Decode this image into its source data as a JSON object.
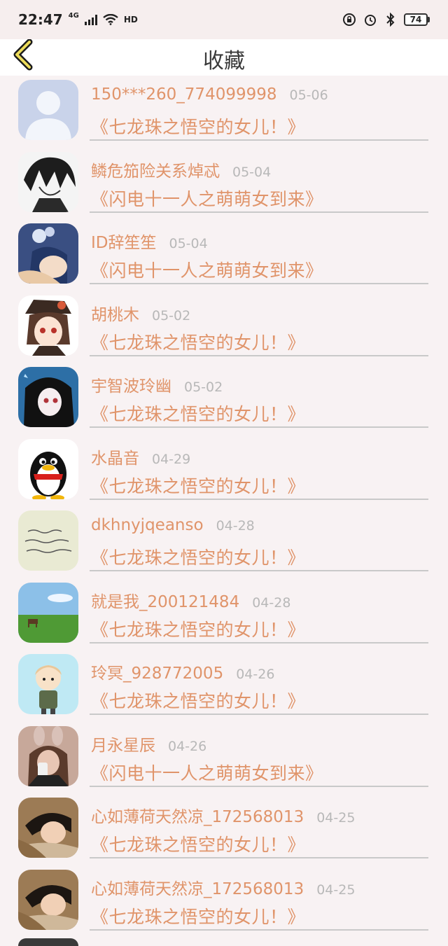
{
  "status": {
    "time": "22:47",
    "network": "4G",
    "hd": "HD",
    "battery": "74"
  },
  "nav": {
    "title": "收藏"
  },
  "colors": {
    "accent": "#e0946a",
    "date": "#b8b8b8",
    "background": "#f8f2f3"
  },
  "items": [
    {
      "user": "150***260_774099998",
      "date": "05-06",
      "title": "《七龙珠之悟空的女儿！》",
      "avatar": "default-avatar"
    },
    {
      "user": "鳞危笳险关系焯忒",
      "date": "05-04",
      "title": "《闪电十一人之萌萌女到来》",
      "avatar": "anime-boy-avatar"
    },
    {
      "user": "ID辞笙笙",
      "date": "05-04",
      "title": "《闪电十一人之萌萌女到来》",
      "avatar": "anime-girl-blue-avatar"
    },
    {
      "user": "胡桃木",
      "date": "05-02",
      "title": "《七龙珠之悟空的女儿！》",
      "avatar": "anime-girl-hat-avatar"
    },
    {
      "user": "宇智波玲幽",
      "date": "05-02",
      "title": "《七龙珠之悟空的女儿！》",
      "avatar": "anime-girl-dark-avatar"
    },
    {
      "user": "水晶音",
      "date": "04-29",
      "title": "《七龙珠之悟空的女儿！》",
      "avatar": "penguin-avatar"
    },
    {
      "user": "dkhnyjqeanso",
      "date": "04-28",
      "title": "《七龙珠之悟空的女儿！》",
      "avatar": "handwriting-avatar"
    },
    {
      "user": "就是我_200121484",
      "date": "04-28",
      "title": "《七龙珠之悟空的女儿！》",
      "avatar": "grassland-avatar"
    },
    {
      "user": "玲冥_928772005",
      "date": "04-26",
      "title": "《七龙珠之悟空的女儿！》",
      "avatar": "cartoon-kid-avatar"
    },
    {
      "user": "月永星辰",
      "date": "04-26",
      "title": "《闪电十一人之萌萌女到来》",
      "avatar": "photo-girl-avatar"
    },
    {
      "user": "心如薄荷天然凉_172568013",
      "date": "04-25",
      "title": "《七龙珠之悟空的女儿！》",
      "avatar": "photo-boy-avatar"
    },
    {
      "user": "心如薄荷天然凉_172568013",
      "date": "04-25",
      "title": "《七龙珠之悟空的女儿！》",
      "avatar": "photo-boy-avatar"
    }
  ]
}
